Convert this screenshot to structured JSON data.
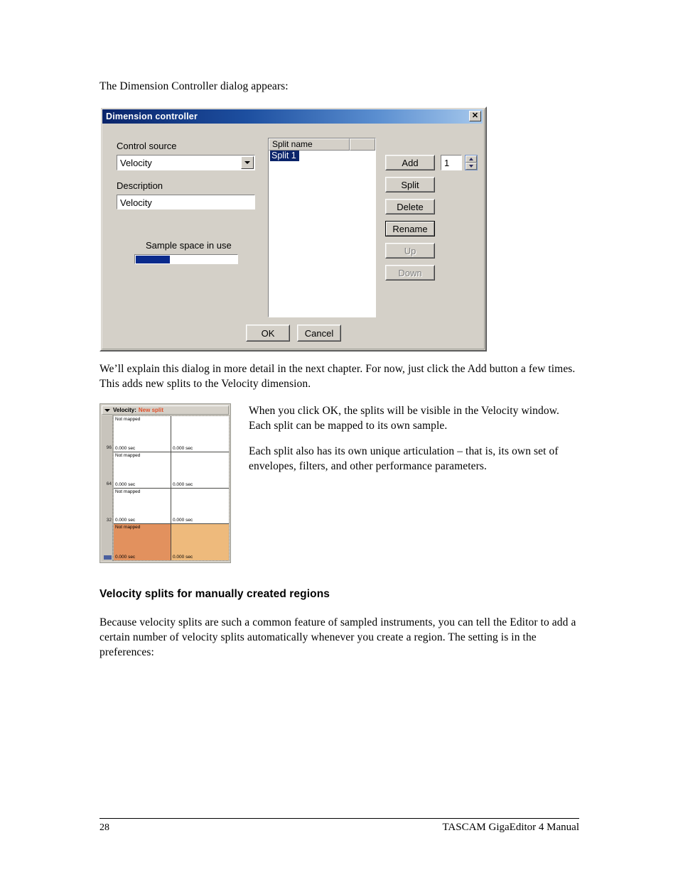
{
  "page": {
    "intro_line": "The Dimension Controller dialog appears:",
    "paragraph_after_dialog": [
      "We’ll explain this dialog in more detail in the next chapter.  For now, just click the Add button a few times.",
      "This adds new splits to the Velocity dimension."
    ],
    "side_paragraph_1": [
      "When you click OK, the splits will be visible in the Velocity window.",
      "Each split can be mapped to its own sample."
    ],
    "side_paragraph_2": [
      "Each split also has its own unique articulation – that is, its own set of",
      "envelopes, filters, and other performance parameters."
    ],
    "section_heading": "Velocity splits for manually created regions",
    "section_paragraph": [
      "Because velocity splits are such a common feature of sampled instruments, you can tell the Editor to add a",
      "certain number of velocity splits automatically whenever you create a region.  The setting is in the",
      "preferences:"
    ]
  },
  "dialog": {
    "title": "Dimension controller",
    "close_glyph": "✕",
    "control_source_label": "Control source",
    "control_source_value": "Velocity",
    "description_label": "Description",
    "description_value": "Velocity",
    "sample_space_label": "Sample space in use",
    "sample_space_percent": 33,
    "list": {
      "columns": [
        "Split name",
        ""
      ],
      "rows": [
        "Split 1"
      ],
      "selected_index": 0
    },
    "buttons": {
      "add": "Add",
      "split": "Split",
      "delete": "Delete",
      "rename": "Rename",
      "up": "Up",
      "down": "Down",
      "ok": "OK",
      "cancel": "Cancel"
    },
    "spinner_value": "1",
    "colors": {
      "titlebar_dark": "#0a246a",
      "titlebar_light": "#a6c8ec",
      "face": "#d4d0c8",
      "selection": "#0a246a",
      "progress": "#0a2a8c"
    }
  },
  "velocity_window": {
    "title_prefix": "Velocity:",
    "title_status": "New split",
    "axis_ticks": [
      "96",
      "64",
      "32"
    ],
    "rows": [
      {
        "left": {
          "label": "Not mapped",
          "time": "0.000 sec",
          "color": "#ffffff"
        },
        "right": {
          "label": "",
          "time": "0.000 sec",
          "color": "#ffffff"
        }
      },
      {
        "left": {
          "label": "Not mapped",
          "time": "0.000 sec",
          "color": "#ffffff"
        },
        "right": {
          "label": "",
          "time": "0.000 sec",
          "color": "#ffffff"
        }
      },
      {
        "left": {
          "label": "Not mapped",
          "time": "0.000 sec",
          "color": "#ffffff"
        },
        "right": {
          "label": "",
          "time": "0.000 sec",
          "color": "#ffffff"
        }
      },
      {
        "left": {
          "label": "Not mapped",
          "time": "0.000 sec",
          "color": "#e2915e"
        },
        "right": {
          "label": "",
          "time": "0.000 sec",
          "color": "#eeba7c"
        }
      }
    ]
  },
  "footer": {
    "page_number": "28",
    "manual_title": "TASCAM GigaEditor 4 Manual"
  }
}
